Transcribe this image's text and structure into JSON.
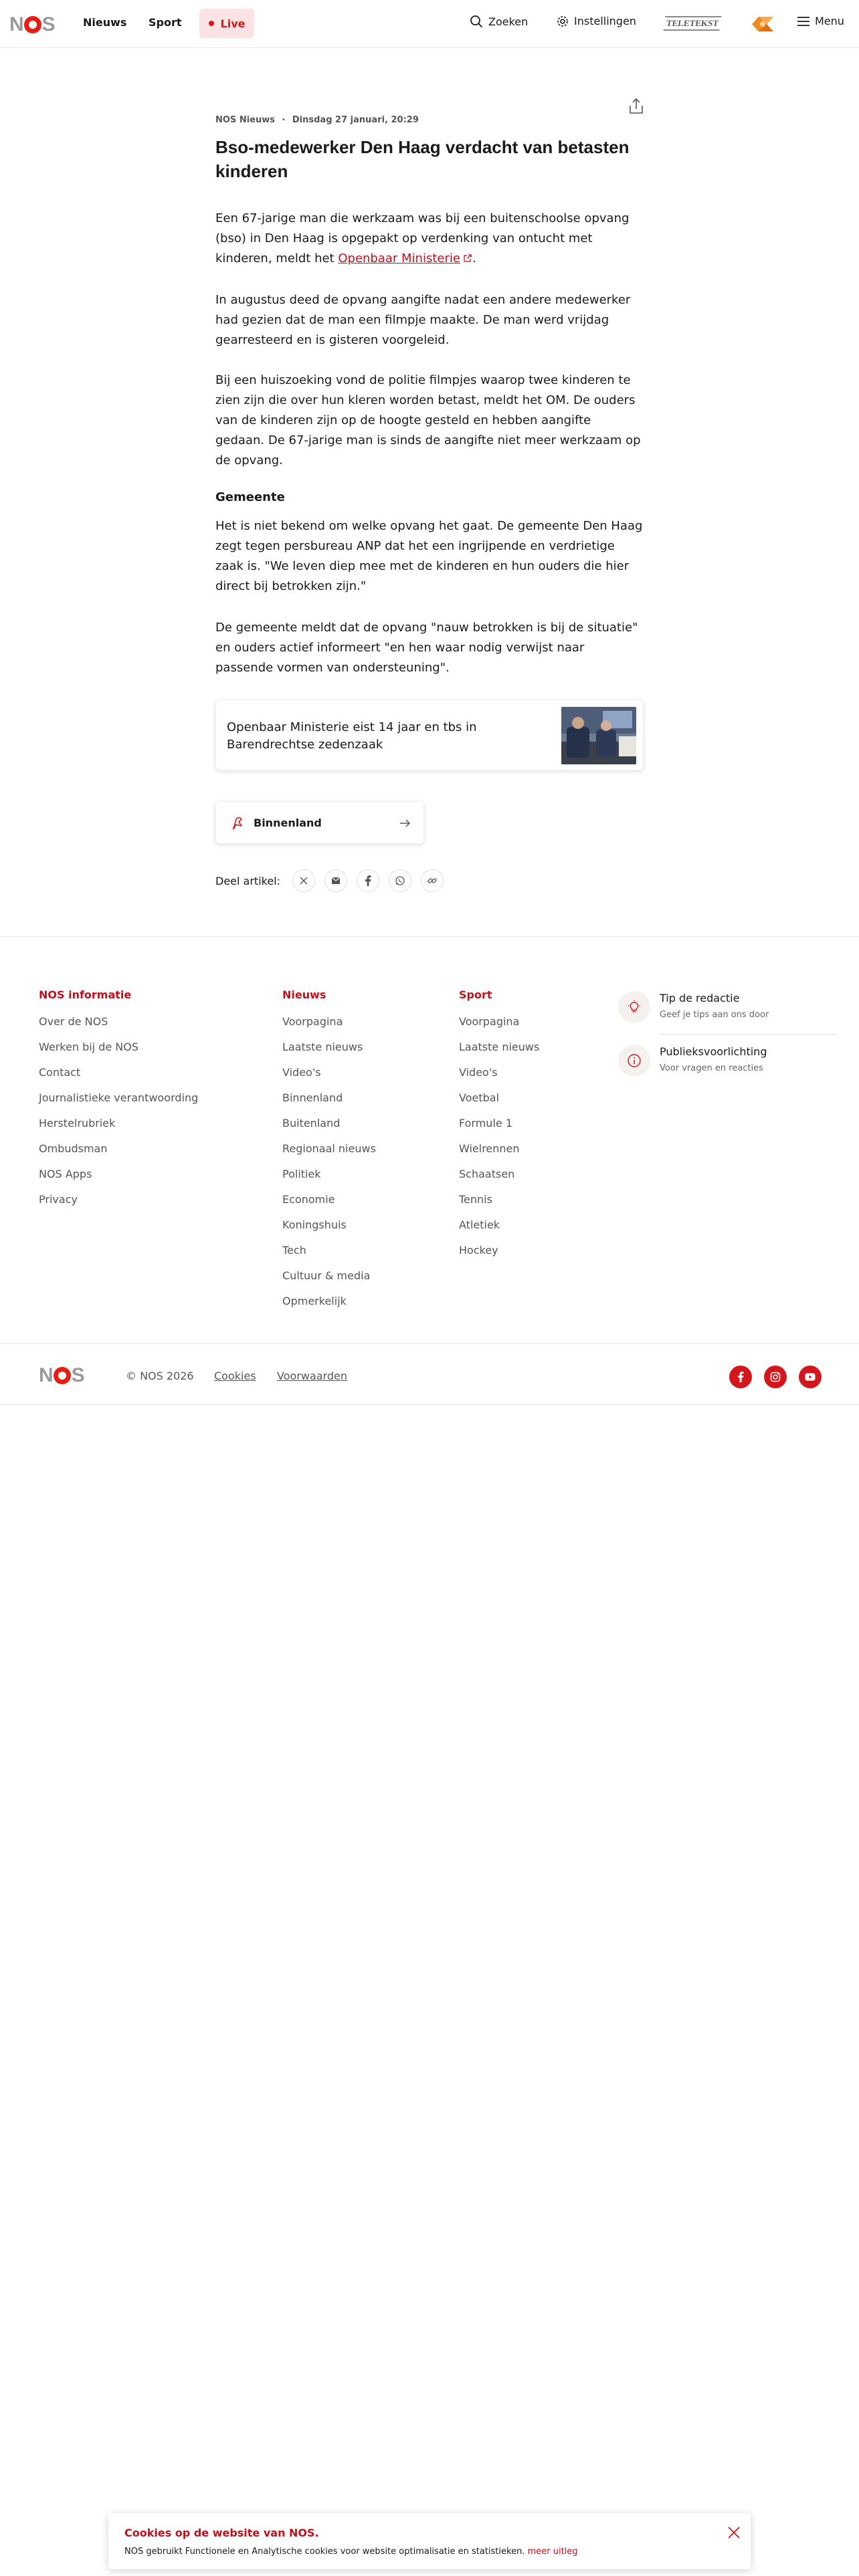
{
  "header": {
    "logo": {
      "n": "N",
      "s": "S"
    },
    "nav": [
      "Nieuws",
      "Sport"
    ],
    "live_label": "Live",
    "search_label": "Zoeken",
    "settings_label": "Instellingen",
    "teletekst_label": "TELETEKST",
    "menu_label": "Menu"
  },
  "article": {
    "source": "NOS Nieuws",
    "date": "Dinsdag 27 januari, 20:29",
    "title": "Bso-medewerker Den Haag verdacht van betasten kinderen",
    "p1_before": "Een 67-jarige man die werkzaam was bij een buitenschoolse opvang (bso) in Den Haag is opgepakt op verdenking van ontucht met kinderen, meldt het ",
    "p1_link": "Openbaar Ministerie",
    "p1_after": ".",
    "p2": "In augustus deed de opvang aangifte nadat een andere medewerker had gezien dat de man een filmpje maakte. De man werd vrijdag gearresteerd en is gisteren voorgeleid.",
    "p3": "Bij een huiszoeking vond de politie filmpjes waarop twee kinderen te zien zijn die over hun kleren worden betast, meldt het OM. De ouders van de kinderen zijn op de hoogte gesteld en hebben aangifte gedaan. De 67-jarige man is sinds de aangifte niet meer werkzaam op de opvang.",
    "subhead": "Gemeente",
    "p4": "Het is niet bekend om welke opvang het gaat. De gemeente Den Haag zegt tegen persbureau ANP dat het een ingrijpende en verdrietige zaak is. \"We leven diep mee met de kinderen en hun ouders die hier direct bij betrokken zijn.\"",
    "p5": "De gemeente meldt dat de opvang \"nauw betrokken is bij de situatie\" en ouders actief informeert \"en hen waar nodig verwijst naar passende vormen van ondersteuning\".",
    "related_title": "Openbaar Ministerie eist 14 jaar en tbs in Barendrechtse zedenzaak",
    "category": "Binnenland",
    "share_label": "Deel artikel:"
  },
  "footer": {
    "col1": {
      "title": "NOS informatie",
      "links": [
        "Over de NOS",
        "Werken bij de NOS",
        "Contact",
        "Journalistieke verantwoording",
        "Herstelrubriek",
        "Ombudsman",
        "NOS Apps",
        "Privacy"
      ]
    },
    "col2": {
      "title": "Nieuws",
      "links": [
        "Voorpagina",
        "Laatste nieuws",
        "Video's",
        "Binnenland",
        "Buitenland",
        "Regionaal nieuws",
        "Politiek",
        "Economie",
        "Koningshuis",
        "Tech",
        "Cultuur & media",
        "Opmerkelijk"
      ]
    },
    "col3": {
      "title": "Sport",
      "links": [
        "Voorpagina",
        "Laatste nieuws",
        "Video's",
        "Voetbal",
        "Formule 1",
        "Wielrennen",
        "Schaatsen",
        "Tennis",
        "Atletiek",
        "Hockey"
      ]
    },
    "tips": [
      {
        "title": "Tip de redactie",
        "sub": "Geef je tips aan ons door"
      },
      {
        "title": "Publieksvoorlichting",
        "sub": "Voor vragen en reacties"
      }
    ],
    "copyright": "© NOS 2026",
    "cookies_link": "Cookies",
    "terms_link": "Voorwaarden"
  },
  "cookie_banner": {
    "title": "Cookies op de website van NOS.",
    "text": "NOS gebruikt Functionele en Analytische cookies voor website optimalisatie en statistieken.",
    "more": "meer uitleg"
  },
  "colors": {
    "accent": "#c20f1a",
    "live_bg": "#fbe3e3",
    "logo_red": "#e61e14"
  }
}
